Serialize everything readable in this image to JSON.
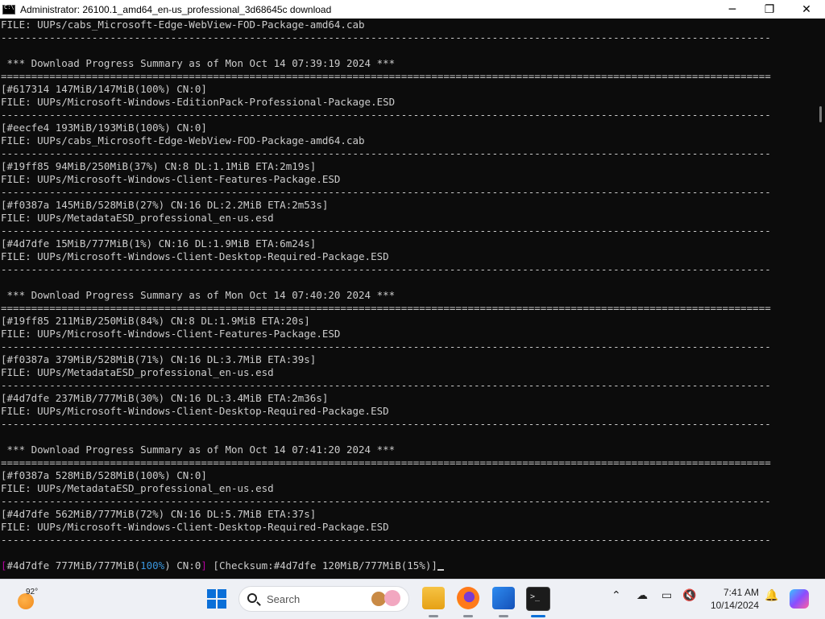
{
  "window": {
    "title": "Administrator:  26100.1_amd64_en-us_professional_3d68645c download",
    "minimize": "─",
    "maximize": "❐",
    "close": "✕"
  },
  "console": {
    "lines": [
      "FILE: UUPs/cabs_Microsoft-Edge-WebView-FOD-Package-amd64.cab",
      "-------------------------------------------------------------------------------------------------------------------------------",
      "",
      " *** Download Progress Summary as of Mon Oct 14 07:39:19 2024 ***",
      "===============================================================================================================================",
      "[#617314 147MiB/147MiB(100%) CN:0]",
      "FILE: UUPs/Microsoft-Windows-EditionPack-Professional-Package.ESD",
      "-------------------------------------------------------------------------------------------------------------------------------",
      "[#eecfe4 193MiB/193MiB(100%) CN:0]",
      "FILE: UUPs/cabs_Microsoft-Edge-WebView-FOD-Package-amd64.cab",
      "-------------------------------------------------------------------------------------------------------------------------------",
      "[#19ff85 94MiB/250MiB(37%) CN:8 DL:1.1MiB ETA:2m19s]",
      "FILE: UUPs/Microsoft-Windows-Client-Features-Package.ESD",
      "-------------------------------------------------------------------------------------------------------------------------------",
      "[#f0387a 145MiB/528MiB(27%) CN:16 DL:2.2MiB ETA:2m53s]",
      "FILE: UUPs/MetadataESD_professional_en-us.esd",
      "-------------------------------------------------------------------------------------------------------------------------------",
      "[#4d7dfe 15MiB/777MiB(1%) CN:16 DL:1.9MiB ETA:6m24s]",
      "FILE: UUPs/Microsoft-Windows-Client-Desktop-Required-Package.ESD",
      "-------------------------------------------------------------------------------------------------------------------------------",
      "",
      " *** Download Progress Summary as of Mon Oct 14 07:40:20 2024 ***",
      "===============================================================================================================================",
      "[#19ff85 211MiB/250MiB(84%) CN:8 DL:1.9MiB ETA:20s]",
      "FILE: UUPs/Microsoft-Windows-Client-Features-Package.ESD",
      "-------------------------------------------------------------------------------------------------------------------------------",
      "[#f0387a 379MiB/528MiB(71%) CN:16 DL:3.7MiB ETA:39s]",
      "FILE: UUPs/MetadataESD_professional_en-us.esd",
      "-------------------------------------------------------------------------------------------------------------------------------",
      "[#4d7dfe 237MiB/777MiB(30%) CN:16 DL:3.4MiB ETA:2m36s]",
      "FILE: UUPs/Microsoft-Windows-Client-Desktop-Required-Package.ESD",
      "-------------------------------------------------------------------------------------------------------------------------------",
      "",
      " *** Download Progress Summary as of Mon Oct 14 07:41:20 2024 ***",
      "===============================================================================================================================",
      "[#f0387a 528MiB/528MiB(100%) CN:0]",
      "FILE: UUPs/MetadataESD_professional_en-us.esd",
      "-------------------------------------------------------------------------------------------------------------------------------",
      "[#4d7dfe 562MiB/777MiB(72%) CN:16 DL:5.7MiB ETA:37s]",
      "FILE: UUPs/Microsoft-Windows-Client-Desktop-Required-Package.ESD",
      "-------------------------------------------------------------------------------------------------------------------------------",
      ""
    ],
    "status": {
      "open_bracket": "[",
      "id_size": "#4d7dfe 777MiB/777MiB(",
      "percent": "100%",
      "cn": ") CN:0",
      "close_bracket": "]",
      "checksum": " [Checksum:#4d7dfe 120MiB/777MiB(15%)]"
    }
  },
  "taskbar": {
    "temperature": "92°",
    "search_placeholder": "Search",
    "clock_time": "7:41 AM",
    "clock_date": "10/14/2024"
  }
}
